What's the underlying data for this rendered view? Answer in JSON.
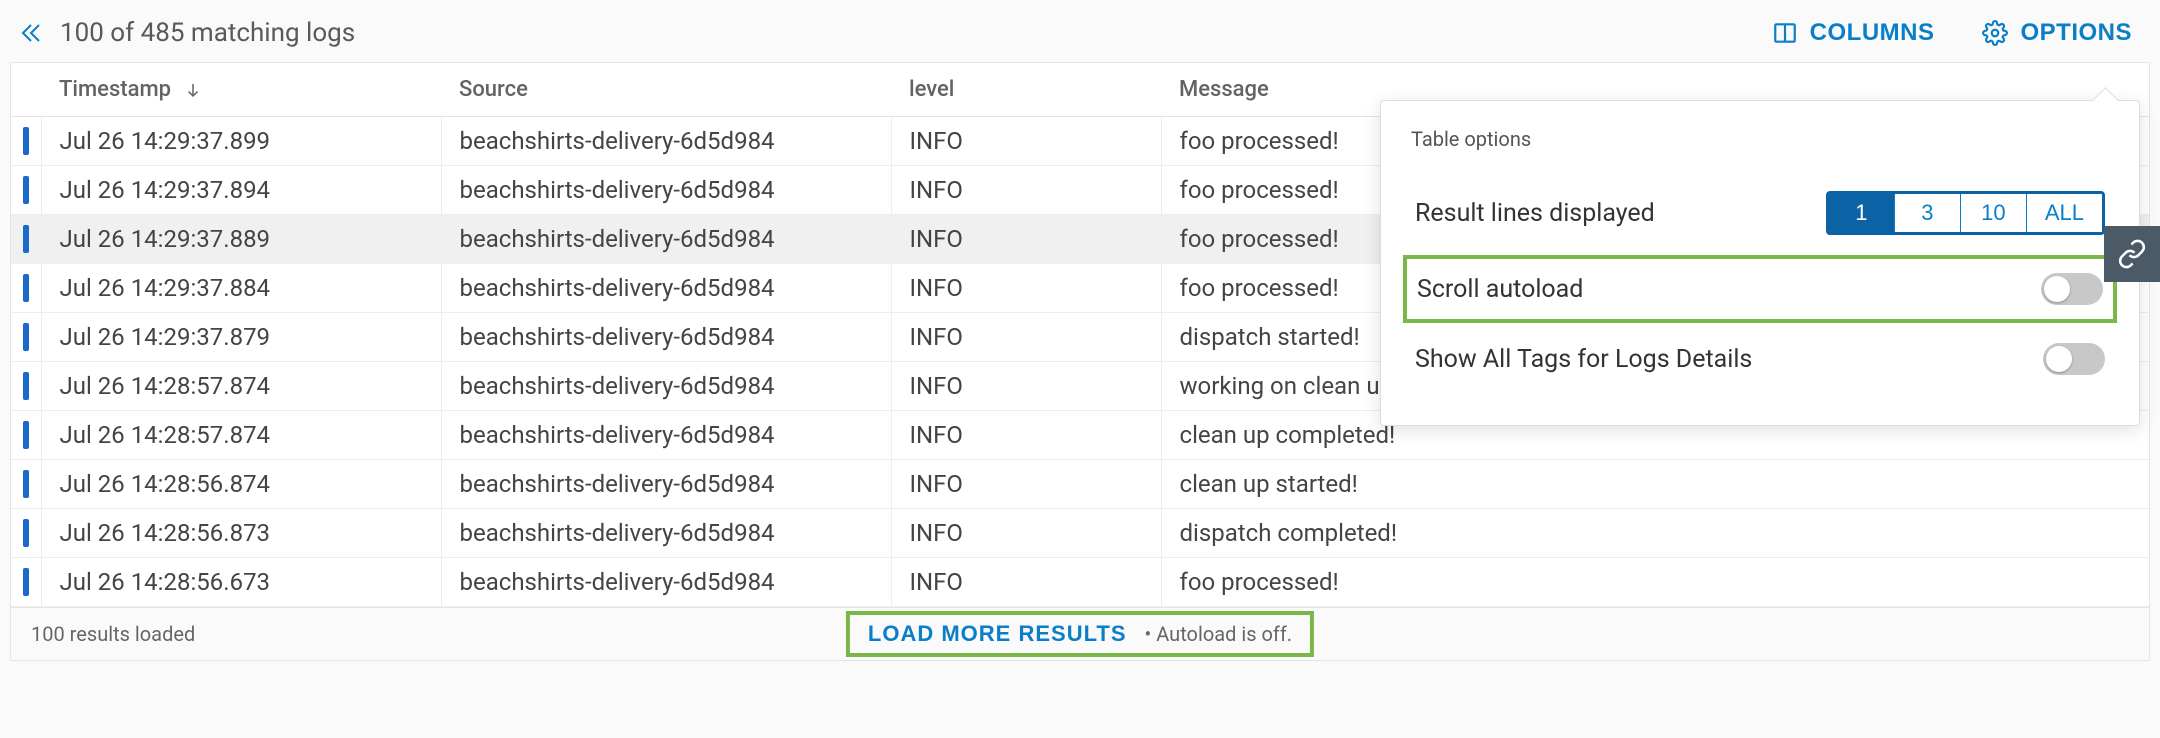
{
  "header": {
    "matching_summary": "100 of 485 matching logs",
    "columns_btn": "COLUMNS",
    "options_btn": "OPTIONS"
  },
  "table": {
    "columns": {
      "timestamp": "Timestamp",
      "source": "Source",
      "level": "level",
      "message": "Message"
    },
    "rows": [
      {
        "timestamp": "Jul 26 14:29:37.899",
        "source": "beachshirts-delivery-6d5d984",
        "level": "INFO",
        "message": "foo processed!",
        "highlight": false
      },
      {
        "timestamp": "Jul 26 14:29:37.894",
        "source": "beachshirts-delivery-6d5d984",
        "level": "INFO",
        "message": "foo processed!",
        "highlight": false
      },
      {
        "timestamp": "Jul 26 14:29:37.889",
        "source": "beachshirts-delivery-6d5d984",
        "level": "INFO",
        "message": "foo processed!",
        "highlight": true
      },
      {
        "timestamp": "Jul 26 14:29:37.884",
        "source": "beachshirts-delivery-6d5d984",
        "level": "INFO",
        "message": "foo processed!",
        "highlight": false
      },
      {
        "timestamp": "Jul 26 14:29:37.879",
        "source": "beachshirts-delivery-6d5d984",
        "level": "INFO",
        "message": "dispatch started!",
        "highlight": false
      },
      {
        "timestamp": "Jul 26 14:28:57.874",
        "source": "beachshirts-delivery-6d5d984",
        "level": "INFO",
        "message": "working on clean up",
        "highlight": false
      },
      {
        "timestamp": "Jul 26 14:28:57.874",
        "source": "beachshirts-delivery-6d5d984",
        "level": "INFO",
        "message": "clean up completed!",
        "highlight": false
      },
      {
        "timestamp": "Jul 26 14:28:56.874",
        "source": "beachshirts-delivery-6d5d984",
        "level": "INFO",
        "message": "clean up started!",
        "highlight": false
      },
      {
        "timestamp": "Jul 26 14:28:56.873",
        "source": "beachshirts-delivery-6d5d984",
        "level": "INFO",
        "message": "dispatch completed!",
        "highlight": false
      },
      {
        "timestamp": "Jul 26 14:28:56.673",
        "source": "beachshirts-delivery-6d5d984",
        "level": "INFO",
        "message": "foo processed!",
        "highlight": false
      }
    ]
  },
  "footer": {
    "results_loaded": "100 results loaded",
    "load_more": "LOAD MORE RESULTS",
    "autoload_hint": "Autoload is off."
  },
  "options_panel": {
    "title": "Table options",
    "lines_label": "Result lines displayed",
    "segments": {
      "one": "1",
      "three": "3",
      "ten": "10",
      "all": "ALL"
    },
    "selected_segment": "1",
    "scroll_autoload_label": "Scroll autoload",
    "scroll_autoload_on": false,
    "show_tags_label": "Show All Tags for Logs Details",
    "show_tags_on": false
  },
  "colors": {
    "accent": "#0b7ec8",
    "highlight_green": "#7ab648",
    "row_marker": "#1b69c9",
    "side_tab": "#4a5a66"
  }
}
